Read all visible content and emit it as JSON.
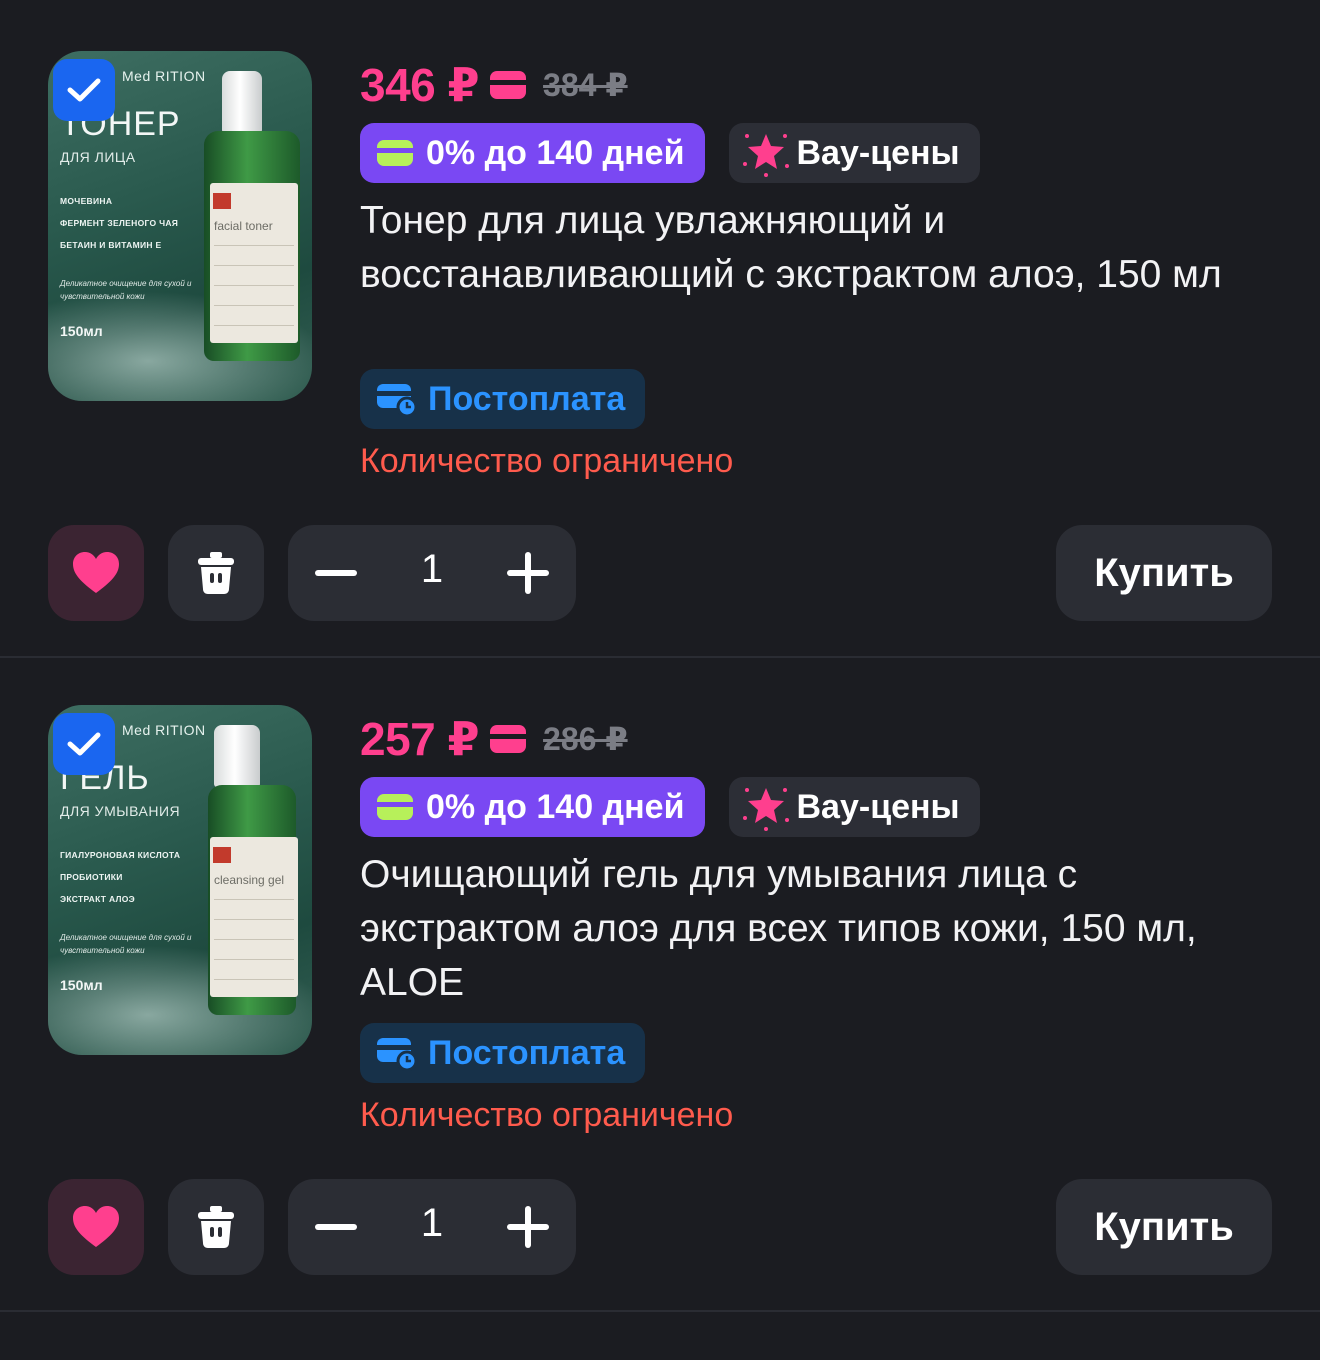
{
  "colors": {
    "background": "#1b1c21",
    "price_pink": "#ff3f8e",
    "installment_purple": "#7a48f3",
    "postpay_blue": "#2b93ff",
    "limited_red": "#ff5b4d",
    "checkbox_blue": "#1a66f0"
  },
  "products": [
    {
      "selected": true,
      "price": "346 ₽",
      "old_price": "384 ₽",
      "installment_badge": "0% до 140 дней",
      "wow_badge": "Вау-цены",
      "name": "Тонер для лица увлажняющий и восстанавливающий с экстрактом алоэ, 150 мл",
      "postpay": "Постоплата",
      "limited": "Количество ограничено",
      "quantity": "1",
      "buy_label": "Купить",
      "image": {
        "brand": "Med RITION",
        "title": "ТОНЕР",
        "subtitle": "ДЛЯ ЛИЦА",
        "ingredients": [
          "МОЧЕВИНА",
          "ФЕРМЕНТ ЗЕЛЕНОГО ЧАЯ",
          "БЕТАИН И ВИТАМИН Е"
        ],
        "description": "Деликатное очищение для сухой и чувствительной кожи",
        "volume": "150мл",
        "bottle_label": "facial toner"
      }
    },
    {
      "selected": true,
      "price": "257 ₽",
      "old_price": "286 ₽",
      "installment_badge": "0% до 140 дней",
      "wow_badge": "Вау-цены",
      "name": "Очищающий гель для умывания лица с экстрактом алоэ для всех типов кожи, 150 мл, ALOE",
      "postpay": "Постоплата",
      "limited": "Количество ограничено",
      "quantity": "1",
      "buy_label": "Купить",
      "image": {
        "brand": "Med RITION",
        "title": "ГЕЛЬ",
        "subtitle": "ДЛЯ УМЫВАНИЯ",
        "ingredients": [
          "ГИАЛУРОНОВАЯ КИСЛОТА",
          "ПРОБИОТИКИ",
          "ЭКСТРАКТ АЛОЭ"
        ],
        "description": "Деликатное очищение для сухой и чувствительной кожи",
        "volume": "150мл",
        "bottle_label": "cleansing gel"
      }
    }
  ]
}
